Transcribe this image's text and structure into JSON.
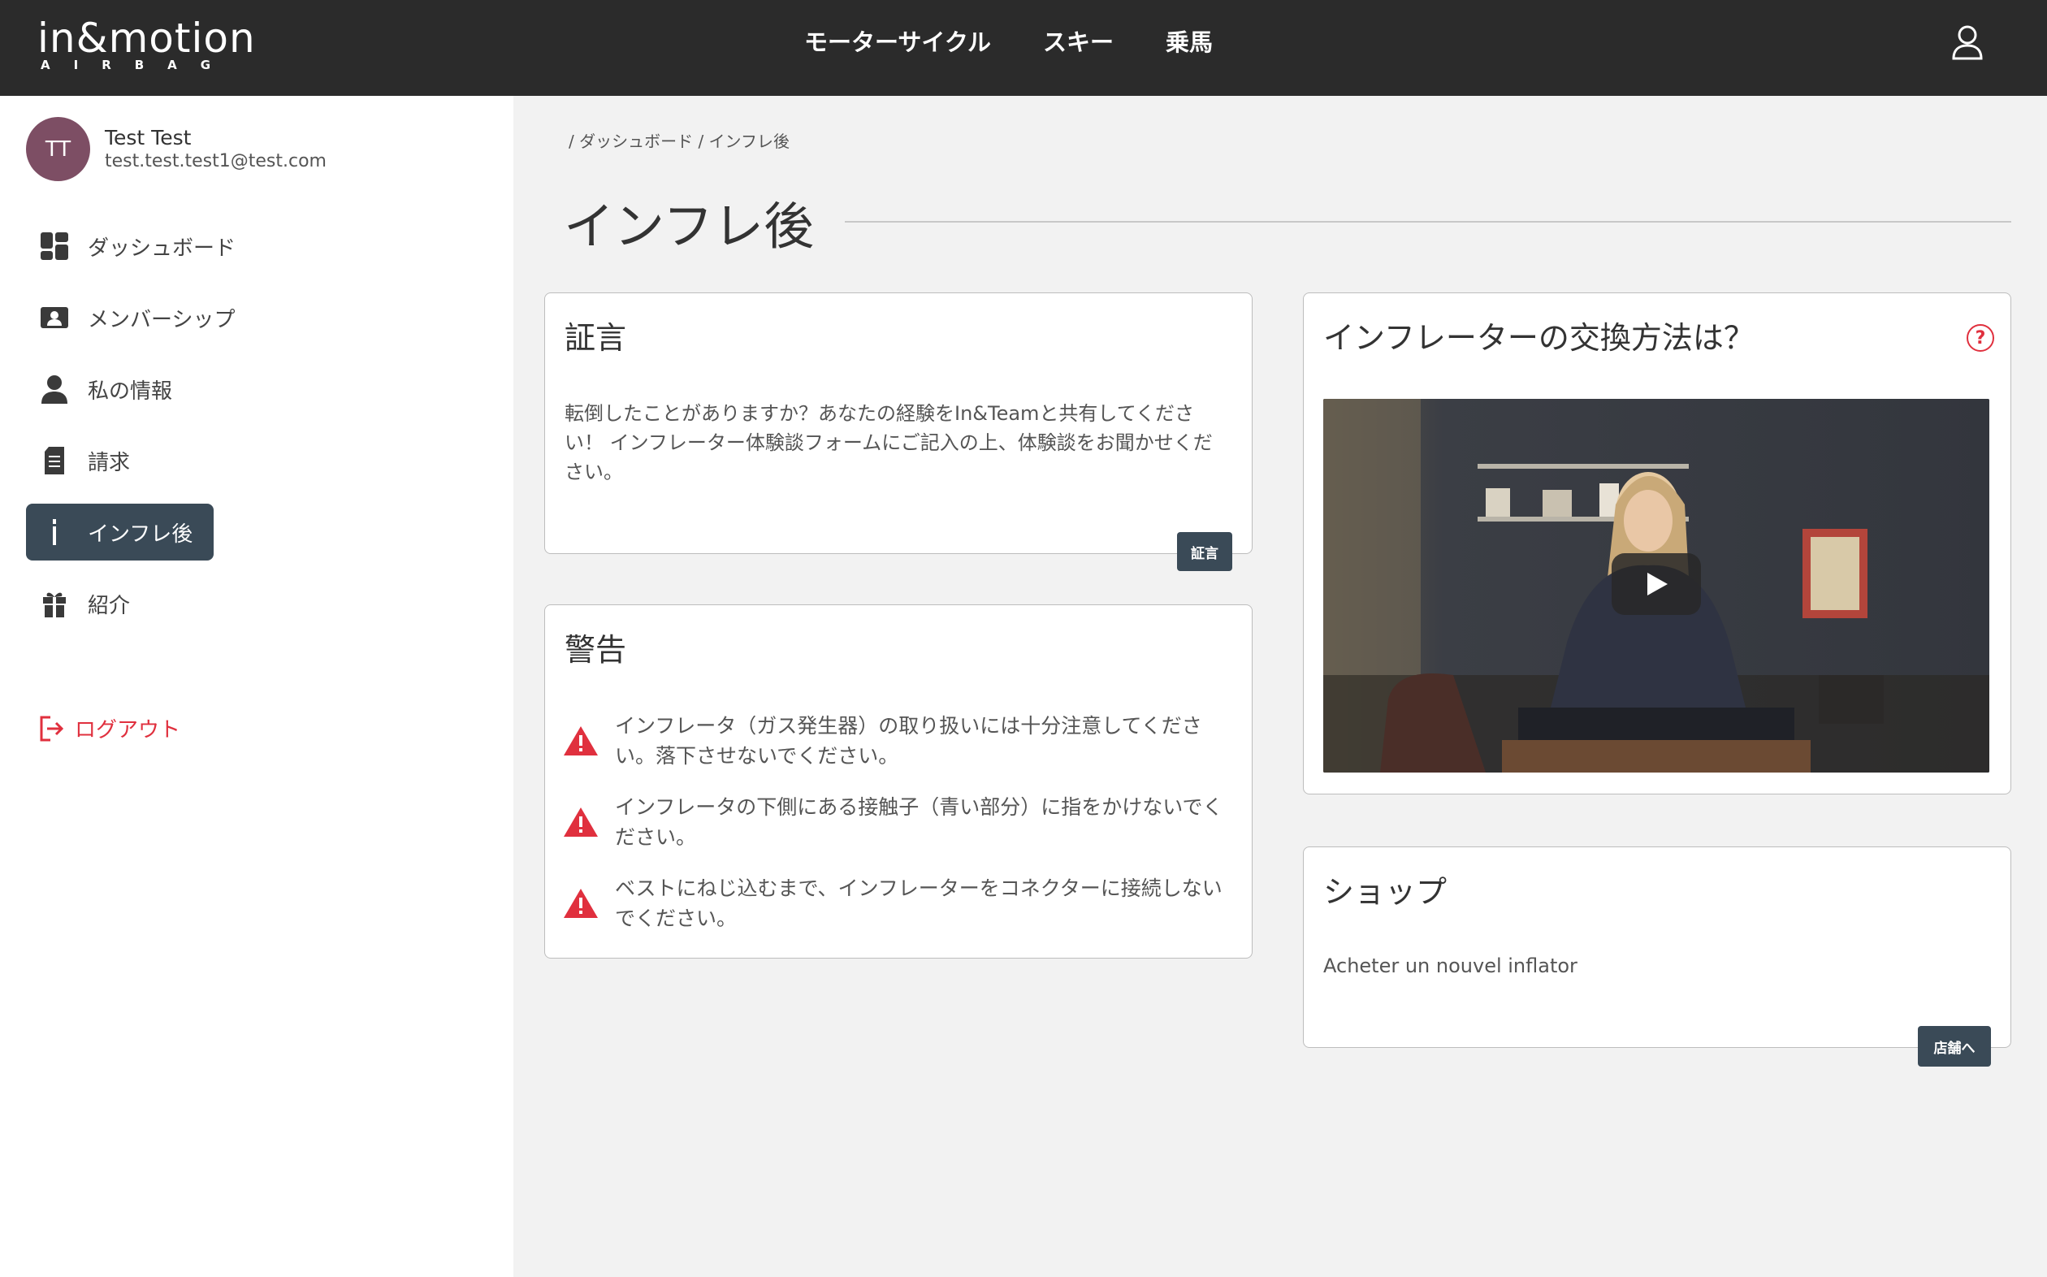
{
  "header": {
    "logo_main": "in&motion",
    "logo_sub": "AIRBAG",
    "nav": [
      "モーターサイクル",
      "スキー",
      "乗馬"
    ]
  },
  "sidebar": {
    "user": {
      "initials": "TT",
      "name": "Test Test",
      "email": "test.test.test1@test.com"
    },
    "items": [
      {
        "label": "ダッシュボード",
        "icon": "dashboard-icon"
      },
      {
        "label": "メンバーシップ",
        "icon": "membership-card-icon"
      },
      {
        "label": "私の情報",
        "icon": "person-icon"
      },
      {
        "label": "請求",
        "icon": "document-icon"
      },
      {
        "label": "インフレ後",
        "icon": "inflator-icon",
        "active": true
      },
      {
        "label": "紹介",
        "icon": "gift-icon"
      }
    ],
    "logout": "ログアウト"
  },
  "main": {
    "breadcrumb": "/ ダッシュボード / インフレ後",
    "title": "インフレ後",
    "testimony": {
      "title": "証言",
      "text": "転倒したことがありますか？あなたの経験をIn&Teamと共有してください！ インフレーター体験談フォームにご記入の上、体験談をお聞かせください。",
      "button": "証言"
    },
    "warning": {
      "title": "警告",
      "items": [
        "インフレータ（ガス発生器）の取り扱いには十分注意してください。落下させないでください。",
        "インフレータの下側にある接触子（青い部分）に指をかけないでください。",
        "ベストにねじ込むまで、インフレーターをコネクターに接続しないでください。"
      ]
    },
    "video_card": {
      "title": "インフレーターの交換方法は？",
      "help": "?"
    },
    "shop": {
      "title": "ショップ",
      "text": "Acheter un nouvel inflator",
      "button": "店舗へ"
    }
  },
  "colors": {
    "accent_dark": "#3a4a57",
    "danger": "#e0303e",
    "topbar": "#2b2b2b",
    "avatar": "#7d4e64"
  }
}
